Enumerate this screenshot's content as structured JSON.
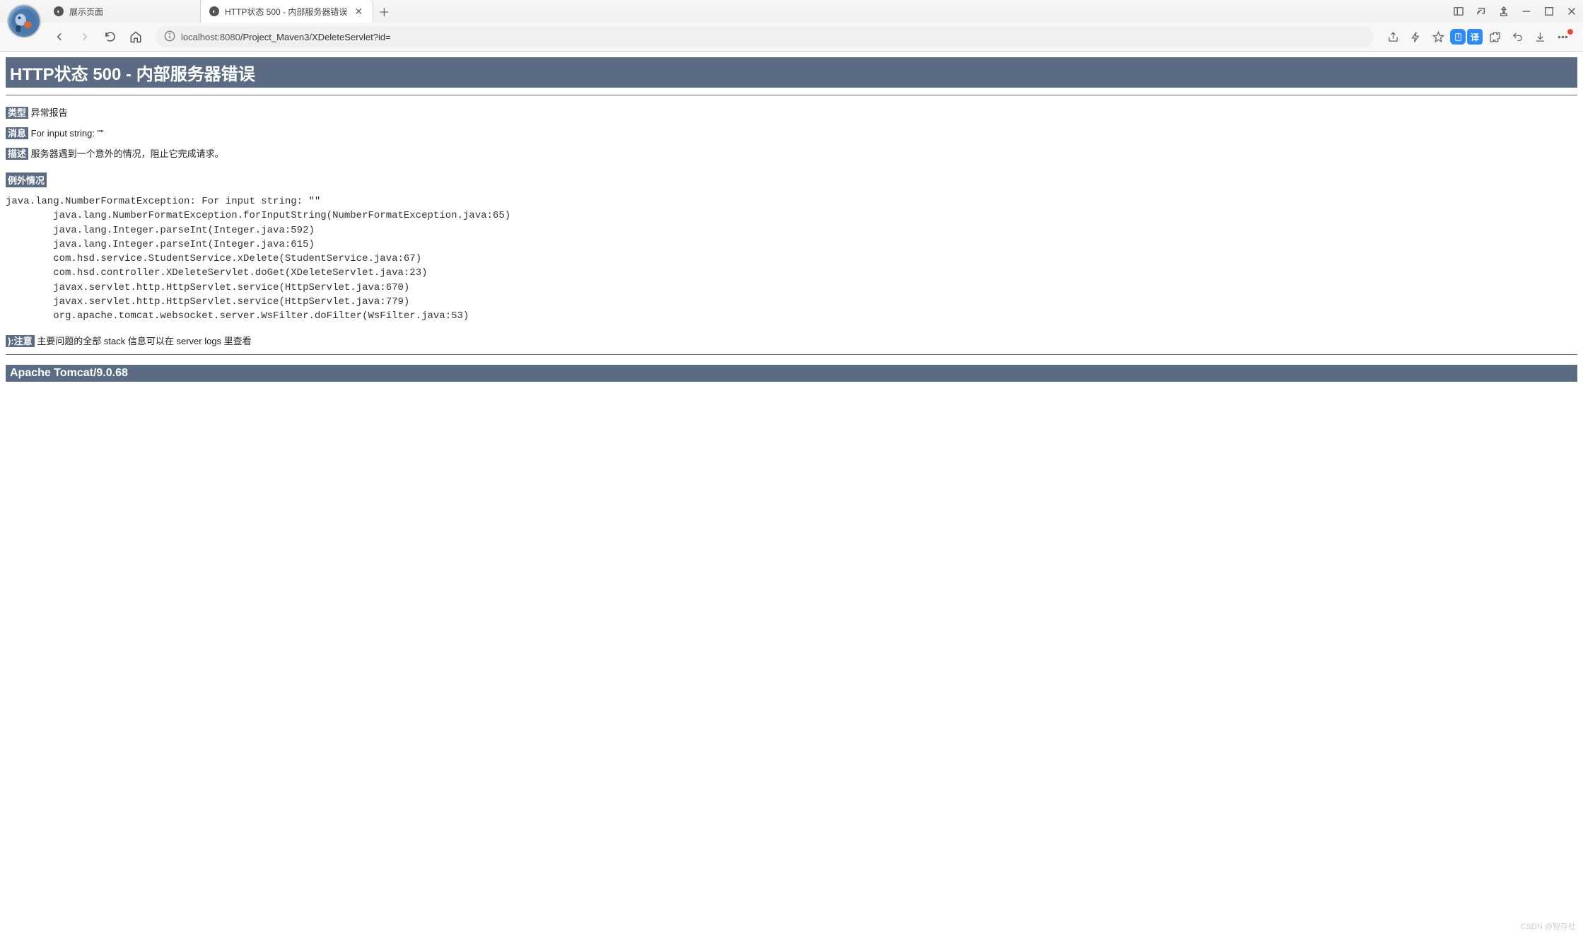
{
  "tabs": [
    {
      "title": "展示页面"
    },
    {
      "title": "HTTP状态 500 - 内部服务器错误"
    }
  ],
  "url": {
    "protocol_icon": "ⓘ",
    "host": "localhost:8080",
    "path": "/Project_Maven3/XDeleteServlet?id="
  },
  "toolbar": {
    "translate_label": "译"
  },
  "page": {
    "heading": "HTTP状态 500 - 内部服务器错误",
    "type_label": "类型",
    "type_value": "异常报告",
    "message_label": "消息",
    "message_value": "For input string: \"\"",
    "description_label": "描述",
    "description_value": "服务器遇到一个意外的情况，阻止它完成请求。",
    "exception_label": "例外情况",
    "stacktrace": "java.lang.NumberFormatException: For input string: \"\"\n        java.lang.NumberFormatException.forInputString(NumberFormatException.java:65)\n        java.lang.Integer.parseInt(Integer.java:592)\n        java.lang.Integer.parseInt(Integer.java:615)\n        com.hsd.service.StudentService.xDelete(StudentService.java:67)\n        com.hsd.controller.XDeleteServlet.doGet(XDeleteServlet.java:23)\n        javax.servlet.http.HttpServlet.service(HttpServlet.java:670)\n        javax.servlet.http.HttpServlet.service(HttpServlet.java:779)\n        org.apache.tomcat.websocket.server.WsFilter.doFilter(WsFilter.java:53)",
    "note_label": "):注意",
    "note_value": "主要问题的全部 stack 信息可以在 server logs 里查看",
    "footer": "Apache Tomcat/9.0.68"
  },
  "watermark": "CSDN @智存社"
}
